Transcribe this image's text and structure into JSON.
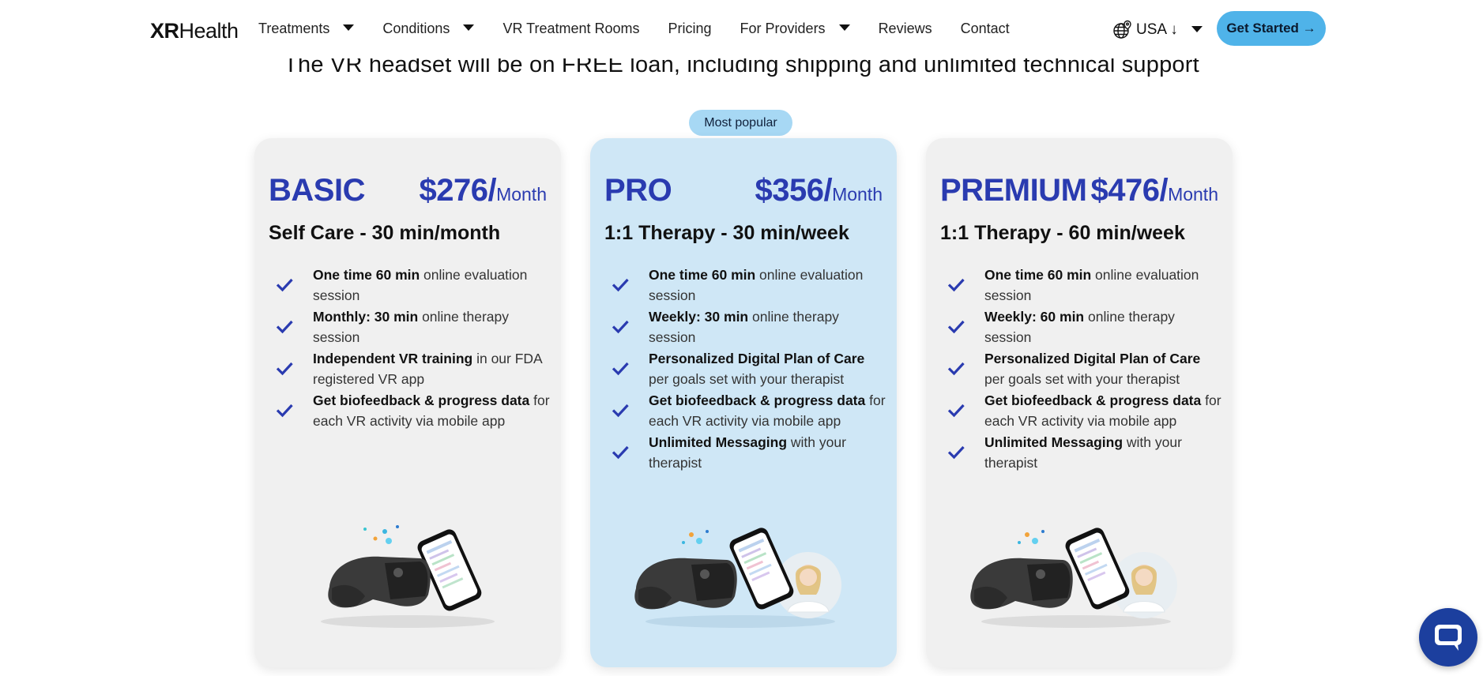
{
  "brand": {
    "logo_bold": "XR",
    "logo_rest": "Health"
  },
  "nav": [
    {
      "label": "Treatments",
      "dropdown": true
    },
    {
      "label": "Conditions",
      "dropdown": true
    },
    {
      "label": "VR Treatment Rooms",
      "dropdown": false
    },
    {
      "label": "Pricing",
      "dropdown": false
    },
    {
      "label": "For Providers",
      "dropdown": true
    },
    {
      "label": "Reviews",
      "dropdown": false
    },
    {
      "label": "Contact",
      "dropdown": false
    }
  ],
  "region": {
    "label": "USA ↓",
    "icon": "globe-pin-icon"
  },
  "cta": {
    "label": "Get Started →"
  },
  "tagline": "The VR headset will be on FREE loan, including shipping and unlimited technical support",
  "badge": "Most popular",
  "plans": [
    {
      "name": "BASIC",
      "price": "$276/",
      "period": "Month",
      "subtitle": "Self Care - 30 min/month",
      "features": [
        {
          "bold": "One time 60 min",
          "rest": " online evaluation session"
        },
        {
          "bold": "Monthly: 30 min",
          "rest": " online therapy session"
        },
        {
          "bold": "Independent VR training",
          "rest": " in our FDA registered VR app"
        },
        {
          "bold": "Get biofeedback & progress data",
          "rest": " for each VR activity via mobile app"
        }
      ]
    },
    {
      "name": "PRO",
      "price": "$356/",
      "period": "Month",
      "subtitle": "1:1 Therapy - 30 min/week",
      "features": [
        {
          "bold": "One time 60 min",
          "rest": " online evaluation session"
        },
        {
          "bold": "Weekly: 30 min",
          "rest": " online therapy session"
        },
        {
          "bold": "Personalized Digital Plan of Care",
          "rest": " per goals set with your therapist"
        },
        {
          "bold": "Get biofeedback & progress data",
          "rest": " for each VR activity via mobile app"
        },
        {
          "bold": "Unlimited Messaging",
          "rest": " with your therapist"
        }
      ]
    },
    {
      "name": "PREMIUM",
      "price": "$476/",
      "period": "Month",
      "subtitle": "1:1 Therapy - 60 min/week",
      "features": [
        {
          "bold": "One time 60 min",
          "rest": " online evaluation session"
        },
        {
          "bold": "Weekly: 60 min",
          "rest": " online therapy session"
        },
        {
          "bold": "Personalized Digital Plan of Care",
          "rest": " per goals set with your therapist"
        },
        {
          "bold": "Get biofeedback & progress data",
          "rest": " for each VR activity via mobile app"
        },
        {
          "bold": "Unlimited Messaging",
          "rest": " with your therapist"
        }
      ]
    }
  ],
  "colors": {
    "accent": "#2a3bb0",
    "cta": "#4fb3e9",
    "badge": "#a7d8f4",
    "pro_card": "#cfe7f6",
    "card": "#f0f0f0",
    "chat": "#1c3f9e"
  }
}
